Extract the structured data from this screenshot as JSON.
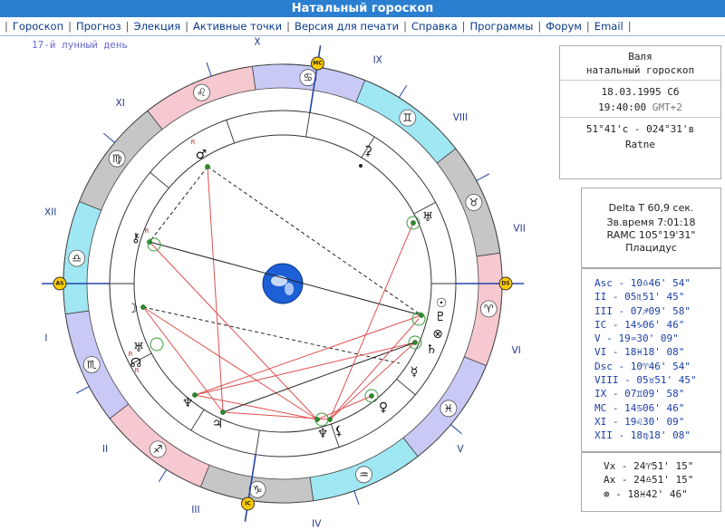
{
  "title": "Натальный гороскоп",
  "nav": [
    "Гороскоп",
    "Прогноз",
    "Элекция",
    "Активные точки",
    "Версия для печати",
    "Справка",
    "Программы",
    "Форум",
    "Email"
  ],
  "moon_day": "17-й лунный день",
  "houses_roman": [
    "X",
    "IX",
    "VIII",
    "VII",
    "VI",
    "V",
    "IV",
    "III",
    "II",
    "I",
    "XII",
    "XI"
  ],
  "axes": {
    "mc": "MC",
    "ic": "IC",
    "as": "AS",
    "ds": "DS"
  },
  "info": {
    "name": "Валя",
    "subtitle": "натальный гороскоп",
    "date": "18.03.1995 Сб",
    "time": "19:40:00",
    "tz": "GMT+2",
    "coords": "51°41'с - 024°31'в",
    "place": "Ratne"
  },
  "tech": {
    "delta_t": "Delta T  60,9 сек.",
    "sidereal": "Зв.время 7:01:18",
    "ramc": "RAMC 105°19'31\"",
    "system": "Плацидус"
  },
  "cusps": [
    "Asc  - 10♎46' 54\"",
    "II   - 05♏51' 45\"",
    "III  - 07♐09' 58\"",
    "IC   - 14♑06' 46\"",
    "V    - 19♒30' 09\"",
    "VI   - 18♓18' 08\"",
    "Dsc  - 10♈46' 54\"",
    "VIII - 05♉51' 45\"",
    "IX   - 07♊09' 58\"",
    "MC   - 14♋06' 46\"",
    "XI   - 19♌30' 09\"",
    "XII  - 18♍18' 08\""
  ],
  "points": [
    "Vx  - 24♈51' 15\"",
    "Ax  - 24♎51' 15\"",
    "⊗  - 18♓42' 46\""
  ],
  "sign_glyphs": [
    "♋",
    "♊",
    "♉",
    "♈",
    "♓",
    "♒",
    "♑",
    "♐",
    "♏",
    "♎",
    "♍",
    "♌"
  ],
  "planet_glyphs": {
    "mars": "♂",
    "ceres": "⚳",
    "uranus": "♅",
    "chiron": "⚷",
    "moon": "☽",
    "neptune_mark": "♅",
    "node": "☊",
    "pluto": "♇",
    "sun": "☉",
    "saturn": "♄",
    "fortune": "⊗",
    "mercury": "☿",
    "venus": "♀",
    "neptune": "♆",
    "pallas": "⚴",
    "jupiter": "♃",
    "lilith": "⚸",
    "retro": "R"
  },
  "colors": {
    "fire": "#f6c8cf",
    "earth": "#c6c6c6",
    "air": "#9fe7f2",
    "water": "#c9c9f6",
    "titlebar": "#2a7fd0",
    "link": "#0a3a8c",
    "aspect_red": "#e05050",
    "aspect_black": "#222222"
  }
}
